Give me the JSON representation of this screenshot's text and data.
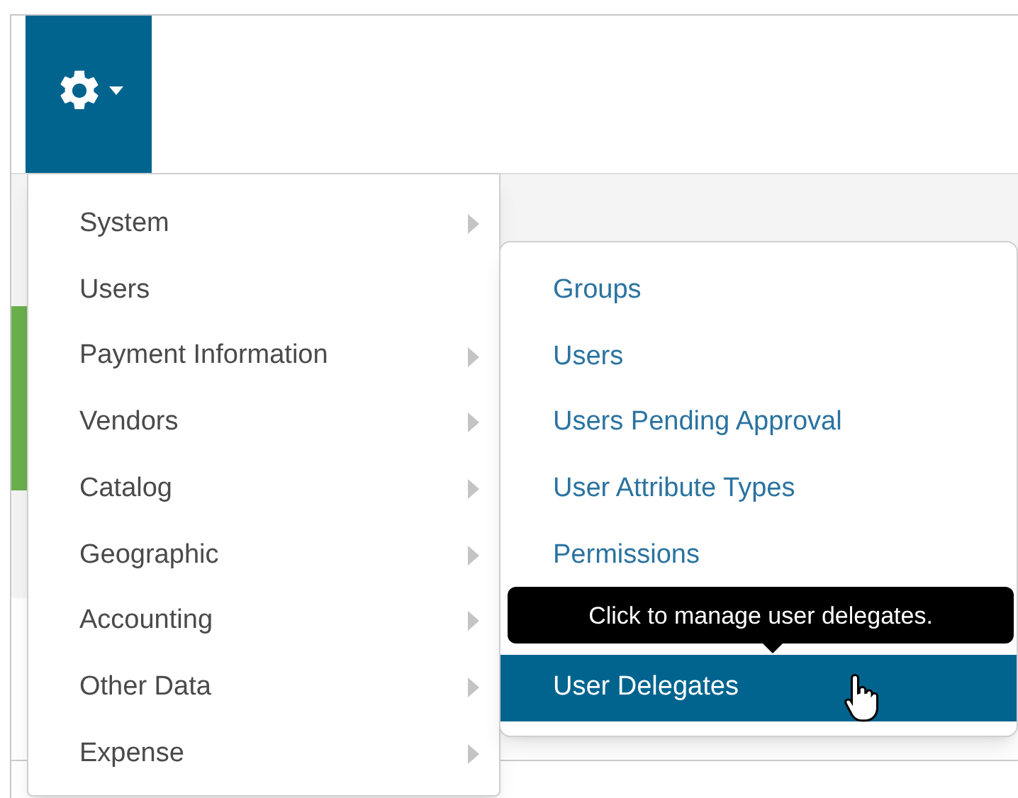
{
  "menu": {
    "items": [
      {
        "label": "System",
        "has_submenu": true
      },
      {
        "label": "Users",
        "has_submenu": false
      },
      {
        "label": "Payment Information",
        "has_submenu": true
      },
      {
        "label": "Vendors",
        "has_submenu": true
      },
      {
        "label": "Catalog",
        "has_submenu": true
      },
      {
        "label": "Geographic",
        "has_submenu": true
      },
      {
        "label": "Accounting",
        "has_submenu": true
      },
      {
        "label": "Other Data",
        "has_submenu": true
      },
      {
        "label": "Expense",
        "has_submenu": true
      }
    ]
  },
  "submenu": {
    "items": [
      {
        "kind": "link",
        "label": "Groups",
        "selected": false
      },
      {
        "kind": "link",
        "label": "Users",
        "selected": false
      },
      {
        "kind": "link",
        "label": "Users Pending Approval",
        "selected": false
      },
      {
        "kind": "link",
        "label": "User Attribute Types",
        "selected": false
      },
      {
        "kind": "link",
        "label": "Permissions",
        "selected": false
      },
      {
        "kind": "tooltip",
        "label": "Click to manage user delegates."
      },
      {
        "kind": "link",
        "label": "User Delegates",
        "selected": true
      }
    ]
  }
}
